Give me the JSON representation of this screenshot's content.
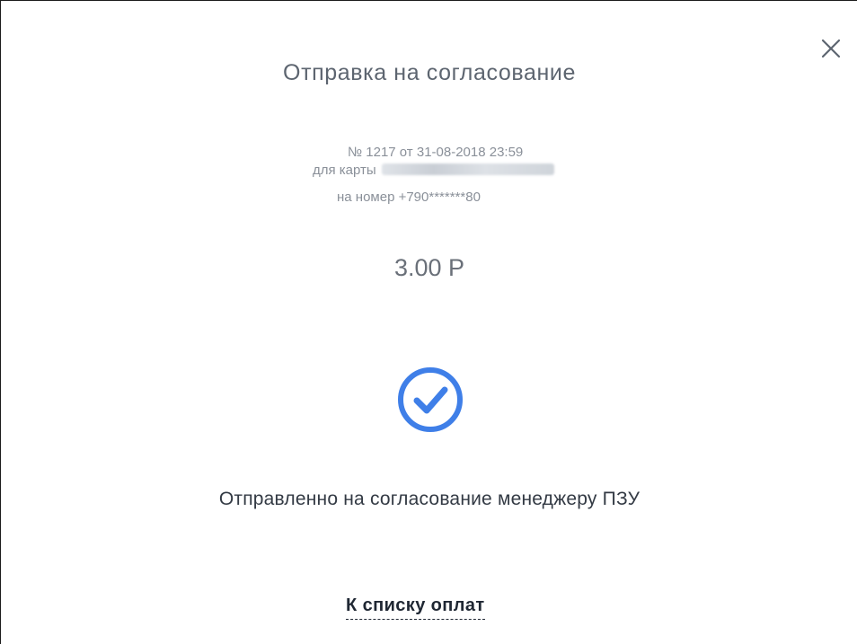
{
  "dialog": {
    "title": "Отправка на согласование",
    "close_icon": "close-icon"
  },
  "details": {
    "number_line": "№ 1217 от 31-08-2018 23:59",
    "card_label": "для карты",
    "phone_line": "на номер +790*******80"
  },
  "amount": "3.00 Р",
  "status": {
    "icon": "check-circle-icon",
    "message": "Отправленно на согласование менеджеру ПЗУ"
  },
  "actions": {
    "back_link": "К списку оплат"
  },
  "colors": {
    "accent": "#3f7fe8",
    "title": "#5d6570",
    "muted": "#8a9099",
    "text": "#333a44"
  }
}
